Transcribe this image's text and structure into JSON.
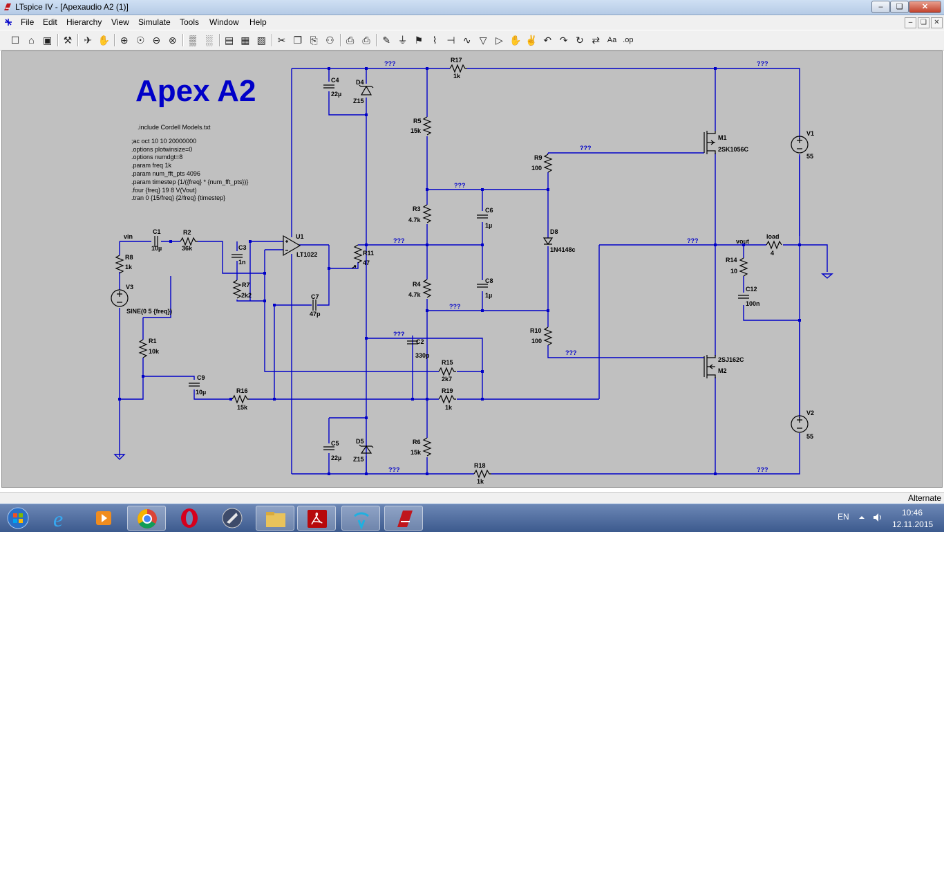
{
  "window": {
    "title": "LTspice IV - [Apexaudio A2 (1)]",
    "minimize": "–",
    "restore": "❏",
    "close": "✕"
  },
  "menu": {
    "items": [
      "File",
      "Edit",
      "Hierarchy",
      "View",
      "Simulate",
      "Tools",
      "Window",
      "Help"
    ],
    "mdi_min": "–",
    "mdi_restore": "❏",
    "mdi_close": "✕"
  },
  "toolbar": {
    "buttons": [
      {
        "name": "new-schematic-icon",
        "glyph": "☐"
      },
      {
        "name": "open-icon",
        "glyph": "⌂"
      },
      {
        "name": "save-icon",
        "glyph": "▣"
      },
      {
        "name": "control-panel-icon",
        "glyph": "⚒"
      },
      {
        "name": "run-icon",
        "glyph": "✈"
      },
      {
        "name": "halt-icon",
        "glyph": "✋"
      },
      {
        "name": "zoom-in-icon",
        "glyph": "⊕"
      },
      {
        "name": "zoom-pan-icon",
        "glyph": "☉"
      },
      {
        "name": "zoom-out-icon",
        "glyph": "⊖"
      },
      {
        "name": "zoom-fit-icon",
        "glyph": "⊗"
      },
      {
        "name": "autoscale-icon",
        "glyph": "▒"
      },
      {
        "name": "grid-icon",
        "glyph": "░"
      },
      {
        "name": "tile-vertical-icon",
        "glyph": "▤"
      },
      {
        "name": "cascade-icon",
        "glyph": "▦"
      },
      {
        "name": "close-window-icon",
        "glyph": "▧"
      },
      {
        "name": "cut-icon",
        "glyph": "✂"
      },
      {
        "name": "copy-icon",
        "glyph": "❐"
      },
      {
        "name": "paste-icon",
        "glyph": "⎘"
      },
      {
        "name": "find-icon",
        "glyph": "⚇"
      },
      {
        "name": "print-setup-icon",
        "glyph": "⎙"
      },
      {
        "name": "print-icon",
        "glyph": "⎙"
      },
      {
        "name": "draw-wire-icon",
        "glyph": "✎"
      },
      {
        "name": "ground-icon",
        "glyph": "⏚"
      },
      {
        "name": "label-net-icon",
        "glyph": "⚑"
      },
      {
        "name": "resistor-icon",
        "glyph": "⌇"
      },
      {
        "name": "capacitor-icon",
        "glyph": "⊣"
      },
      {
        "name": "inductor-icon",
        "glyph": "∿"
      },
      {
        "name": "diode-icon",
        "glyph": "▽"
      },
      {
        "name": "component-icon",
        "glyph": "▷"
      },
      {
        "name": "move-icon",
        "glyph": "✋"
      },
      {
        "name": "drag-icon",
        "glyph": "✌"
      },
      {
        "name": "undo-icon",
        "glyph": "↶"
      },
      {
        "name": "redo-icon",
        "glyph": "↷"
      },
      {
        "name": "rotate-icon",
        "glyph": "↻"
      },
      {
        "name": "mirror-icon",
        "glyph": "⇄"
      },
      {
        "name": "text-icon",
        "glyph": "Aa"
      },
      {
        "name": "spice-directive-icon",
        "glyph": ".op"
      }
    ]
  },
  "schematic": {
    "title": "Apex A2",
    "directives": [
      ".include Cordell Models.txt",
      ";ac oct 10 10 20000000",
      ".options plotwinsize=0",
      ".options numdgt=8",
      ".param freq 1k",
      ".param num_fft_pts 4096",
      ".param timestep {1/({freq} * {num_fft_pts})}",
      ".four {freq} 19 8 V(Vout)",
      ".tran 0 {15/freq} {2/freq} {timestep}"
    ],
    "components": {
      "R17": "1k",
      "R5": "15k",
      "R3": "4.7k",
      "R4": "4.7k",
      "R6": "15k",
      "R18": "1k",
      "R9": "100",
      "R10": "100",
      "R11": "47",
      "R2": "36k",
      "R7": "2k2",
      "R8": "1k",
      "R1": "10k",
      "R16": "15k",
      "R15": "2k7",
      "R19": "1k",
      "R14": "10",
      "load": "4",
      "C4": "22µ",
      "C5": "22µ",
      "C1": "10µ",
      "C3": "1n",
      "C7": "47p",
      "C6": "1µ",
      "C8": "1µ",
      "C2": "330p",
      "C9": "10µ",
      "C12": "100n",
      "D4": "Z15",
      "D5": "Z15",
      "D8": "1N4148c",
      "M1": "2SK1056C",
      "M2": "2SJ162C",
      "U1": "LT1022",
      "V1": "55",
      "V2": "55",
      "V3": "SINE(0 5 {freq})"
    },
    "nets": {
      "vin": "vin",
      "vout": "vout",
      "unknown": "???"
    }
  },
  "status": {
    "mode": "Alternate"
  },
  "taskbar": {
    "apps": [
      "start",
      "internet-explorer",
      "media-player",
      "chrome",
      "opera",
      "app-5",
      "file-explorer",
      "acrobat",
      "app-8",
      "ltspice"
    ],
    "language": "EN",
    "time": "10:46",
    "date": "12.11.2015"
  }
}
